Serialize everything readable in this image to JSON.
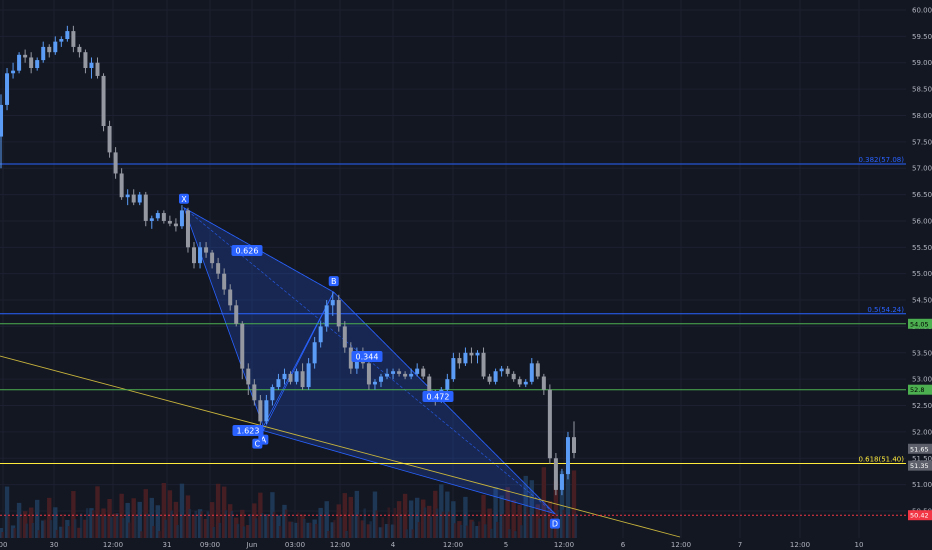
{
  "chart_data": {
    "type": "candlestick",
    "price_axis": {
      "ticks": [
        "60.00",
        "59.50",
        "59.00",
        "58.50",
        "58.00",
        "57.50",
        "57.00",
        "56.50",
        "56.00",
        "55.50",
        "55.00",
        "54.50",
        "54.00",
        "53.50",
        "53.00",
        "52.50",
        "52.00",
        "51.50",
        "51.00",
        "50.50"
      ]
    },
    "time_axis": {
      "ticks": [
        "00",
        "30",
        "12:00",
        "31",
        "09:00",
        "Jun",
        "03:00",
        "12:00",
        "4",
        "12:00",
        "5",
        "12:00",
        "6",
        "12:00",
        "7",
        "12:00",
        "10"
      ]
    },
    "levels": [
      {
        "label": "0.382(57.08)",
        "price": 57.08,
        "color": "#2962ff",
        "tag": ""
      },
      {
        "label": "0.5(54.24)",
        "price": 54.24,
        "color": "#2962ff",
        "tag": ""
      },
      {
        "label": "",
        "price": 54.05,
        "color": "#4caf50",
        "tag": "54.05"
      },
      {
        "label": "",
        "price": 52.8,
        "color": "#4caf50",
        "tag": "52.8"
      },
      {
        "label": "0.618(51.40)",
        "price": 51.4,
        "color": "#ffeb3b",
        "tag": ""
      },
      {
        "label": "",
        "price": 50.42,
        "color": "#f23645",
        "tag": "50.42"
      }
    ],
    "gray_tags": [
      "51.65",
      "51.35"
    ],
    "pattern": {
      "points": [
        {
          "name": "X",
          "price": 56.25
        },
        {
          "name": "A",
          "price": 52.1
        },
        {
          "name": "B",
          "price": 54.65
        },
        {
          "name": "C",
          "price": 52.1
        },
        {
          "name": "D",
          "price": 50.45
        }
      ],
      "ratios": [
        "0.626",
        "0.344",
        "0.472",
        "1.623"
      ]
    },
    "candles": [
      [
        57.6,
        58.4,
        57.0,
        58.2
      ],
      [
        58.2,
        58.9,
        58.1,
        58.8
      ],
      [
        58.8,
        59.0,
        58.7,
        58.85
      ],
      [
        58.85,
        59.2,
        58.8,
        59.15
      ],
      [
        59.15,
        59.25,
        59.0,
        59.1
      ],
      [
        59.1,
        59.2,
        58.8,
        58.9
      ],
      [
        58.9,
        59.1,
        58.85,
        59.05
      ],
      [
        59.05,
        59.4,
        59.0,
        59.3
      ],
      [
        59.3,
        59.35,
        59.1,
        59.2
      ],
      [
        59.2,
        59.5,
        59.15,
        59.4
      ],
      [
        59.4,
        59.5,
        59.3,
        59.45
      ],
      [
        59.45,
        59.7,
        59.4,
        59.6
      ],
      [
        59.6,
        59.7,
        59.2,
        59.3
      ],
      [
        59.3,
        59.35,
        59.1,
        59.2
      ],
      [
        59.2,
        59.25,
        58.8,
        58.9
      ],
      [
        58.9,
        59.1,
        58.7,
        59.0
      ],
      [
        59.0,
        59.1,
        58.7,
        58.75
      ],
      [
        58.75,
        58.8,
        57.7,
        57.8
      ],
      [
        57.8,
        57.9,
        57.2,
        57.3
      ],
      [
        57.3,
        57.4,
        56.8,
        56.9
      ],
      [
        56.9,
        57.0,
        56.4,
        56.45
      ],
      [
        56.45,
        56.6,
        56.3,
        56.5
      ],
      [
        56.5,
        56.6,
        56.3,
        56.35
      ],
      [
        56.35,
        56.55,
        56.3,
        56.5
      ],
      [
        56.5,
        56.55,
        55.9,
        56.0
      ],
      [
        56.0,
        56.1,
        55.85,
        56.05
      ],
      [
        56.05,
        56.2,
        56.0,
        56.15
      ],
      [
        56.15,
        56.2,
        55.95,
        56.0
      ],
      [
        56.0,
        56.1,
        55.9,
        55.95
      ],
      [
        55.95,
        56.05,
        55.8,
        55.9
      ],
      [
        55.9,
        56.3,
        55.85,
        56.2
      ],
      [
        56.2,
        56.25,
        55.4,
        55.5
      ],
      [
        55.5,
        55.6,
        55.1,
        55.2
      ],
      [
        55.2,
        55.6,
        55.1,
        55.5
      ],
      [
        55.5,
        55.6,
        55.3,
        55.4
      ],
      [
        55.4,
        55.45,
        55.1,
        55.2
      ],
      [
        55.2,
        55.3,
        54.9,
        55.0
      ],
      [
        55.0,
        55.1,
        54.6,
        54.7
      ],
      [
        54.7,
        54.8,
        54.3,
        54.4
      ],
      [
        54.4,
        54.5,
        54.0,
        54.05
      ],
      [
        54.05,
        54.1,
        53.0,
        53.2
      ],
      [
        53.2,
        53.3,
        52.7,
        52.9
      ],
      [
        52.9,
        53.0,
        52.5,
        52.6
      ],
      [
        52.6,
        52.7,
        52.1,
        52.2
      ],
      [
        52.2,
        52.7,
        52.15,
        52.6
      ],
      [
        52.6,
        52.9,
        52.5,
        52.85
      ],
      [
        52.85,
        53.1,
        52.8,
        53.0
      ],
      [
        53.0,
        53.2,
        52.9,
        53.1
      ],
      [
        53.1,
        53.15,
        52.9,
        52.95
      ],
      [
        52.95,
        53.2,
        52.9,
        53.15
      ],
      [
        53.15,
        53.3,
        52.8,
        52.85
      ],
      [
        52.85,
        53.4,
        52.8,
        53.3
      ],
      [
        53.3,
        53.8,
        53.2,
        53.7
      ],
      [
        53.7,
        54.1,
        53.6,
        54.0
      ],
      [
        54.0,
        54.5,
        53.9,
        54.4
      ],
      [
        54.4,
        54.65,
        54.2,
        54.5
      ],
      [
        54.5,
        54.6,
        53.9,
        54.0
      ],
      [
        54.0,
        54.1,
        53.5,
        53.6
      ],
      [
        53.6,
        53.7,
        53.1,
        53.2
      ],
      [
        53.2,
        53.6,
        53.1,
        53.5
      ],
      [
        53.5,
        53.6,
        53.2,
        53.3
      ],
      [
        53.3,
        53.4,
        52.8,
        52.9
      ],
      [
        52.9,
        53.0,
        52.8,
        52.95
      ],
      [
        52.95,
        53.1,
        52.85,
        53.05
      ],
      [
        53.05,
        53.2,
        53.0,
        53.1
      ],
      [
        53.1,
        53.2,
        53.0,
        53.15
      ],
      [
        53.15,
        53.2,
        53.05,
        53.1
      ],
      [
        53.1,
        53.15,
        53.0,
        53.05
      ],
      [
        53.05,
        53.2,
        53.0,
        53.1
      ],
      [
        53.1,
        53.3,
        53.05,
        53.2
      ],
      [
        53.2,
        53.25,
        53.0,
        53.05
      ],
      [
        53.05,
        53.1,
        52.6,
        52.7
      ],
      [
        52.7,
        52.8,
        52.5,
        52.6
      ],
      [
        52.6,
        52.85,
        52.55,
        52.8
      ],
      [
        52.8,
        53.1,
        52.75,
        53.0
      ],
      [
        53.0,
        53.5,
        52.95,
        53.4
      ],
      [
        53.4,
        53.5,
        53.2,
        53.3
      ],
      [
        53.3,
        53.6,
        53.25,
        53.5
      ],
      [
        53.5,
        53.6,
        53.3,
        53.45
      ],
      [
        53.45,
        53.55,
        53.3,
        53.5
      ],
      [
        53.5,
        53.6,
        53.0,
        53.05
      ],
      [
        53.05,
        53.1,
        52.9,
        52.95
      ],
      [
        52.95,
        53.2,
        52.9,
        53.15
      ],
      [
        53.15,
        53.25,
        53.05,
        53.2
      ],
      [
        53.2,
        53.25,
        53.05,
        53.1
      ],
      [
        53.1,
        53.15,
        52.95,
        53.0
      ],
      [
        53.0,
        53.05,
        52.85,
        52.9
      ],
      [
        52.9,
        53.0,
        52.85,
        52.95
      ],
      [
        52.95,
        53.4,
        52.9,
        53.3
      ],
      [
        53.3,
        53.35,
        53.0,
        53.05
      ],
      [
        53.05,
        53.1,
        52.7,
        52.8
      ],
      [
        52.8,
        52.9,
        51.4,
        51.5
      ],
      [
        51.5,
        51.6,
        50.8,
        50.9
      ],
      [
        50.9,
        51.3,
        50.8,
        51.2
      ],
      [
        51.2,
        52.0,
        51.1,
        51.9
      ],
      [
        51.9,
        52.2,
        51.5,
        51.6
      ]
    ]
  }
}
